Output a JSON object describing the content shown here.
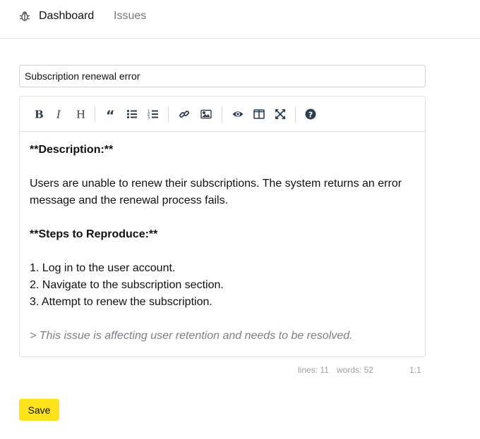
{
  "nav": {
    "brand_icon": "bug-icon",
    "dashboard_label": "Dashboard",
    "issues_label": "Issues"
  },
  "issue": {
    "title_value": "Subscription renewal error"
  },
  "toolbar": {
    "buttons": [
      "bold",
      "italic",
      "heading",
      "quote",
      "unordered-list",
      "ordered-list",
      "link",
      "image",
      "preview",
      "side-by-side",
      "fullscreen",
      "guide"
    ]
  },
  "editor": {
    "line1": "**Description:**",
    "line2": "Users are unable to renew their subscriptions. The system returns an error message and the renewal process fails.",
    "line3": "**Steps to Reproduce:**",
    "line4": "1. Log in to the user account.",
    "line5": "2. Navigate to the subscription section.",
    "line6": "3. Attempt to renew the subscription.",
    "line7": "> This issue is affecting user retention and needs to be resolved."
  },
  "status": {
    "lines": "lines: 11",
    "words": "words: 52",
    "cursor": "1:1"
  },
  "actions": {
    "save_label": "Save"
  },
  "colors": {
    "save_button": "#ffe31a",
    "toolbar_icon": "#2c3e50",
    "quote_text": "#7a7f86"
  }
}
